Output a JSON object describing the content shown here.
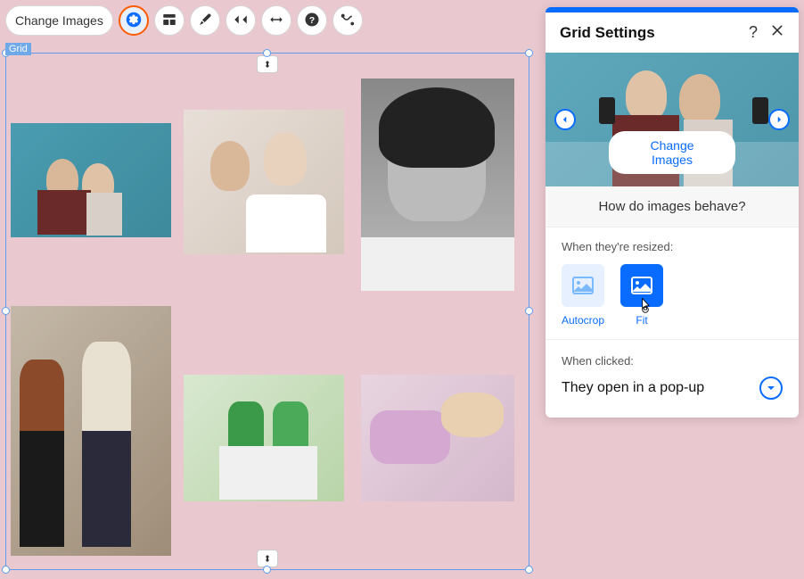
{
  "toolbar": {
    "change_images": "Change Images",
    "icons": [
      "gear-icon",
      "grid-icon",
      "brush-icon",
      "layers-icon",
      "stretch-icon",
      "help-icon",
      "animation-icon"
    ]
  },
  "stage": {
    "element_label": "Grid"
  },
  "panel": {
    "title": "Grid Settings",
    "hero_button": "Change Images",
    "behave_heading": "How do images behave?",
    "resized_label": "When they're resized:",
    "mode_autocrop": "Autocrop",
    "mode_fit": "Fit",
    "clicked_label": "When clicked:",
    "clicked_value": "They open in a pop-up"
  }
}
